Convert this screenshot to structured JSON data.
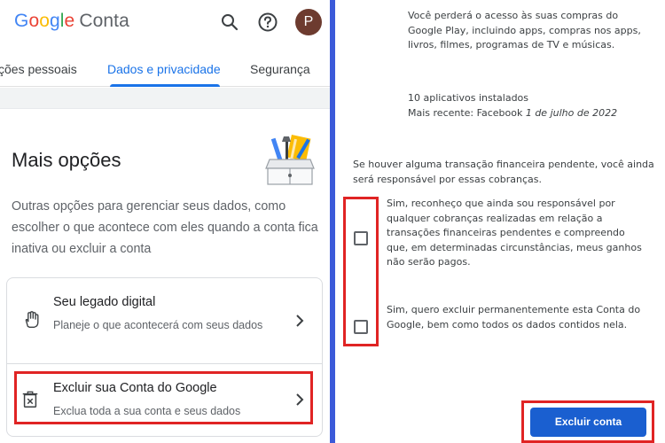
{
  "header": {
    "logo_google": [
      "G",
      "o",
      "o",
      "g",
      "l",
      "e"
    ],
    "logo_conta": "Conta",
    "avatar_letter": "P"
  },
  "tabs": [
    {
      "label": "ções pessoais"
    },
    {
      "label": "Dados e privacidade",
      "active": true
    },
    {
      "label": "Segurança"
    }
  ],
  "main": {
    "title": "Mais opções",
    "description": "Outras opções para gerenciar seus dados, como escolher o que acontece com eles quando a conta fica inativa ou excluir a conta"
  },
  "options": [
    {
      "title": "Seu legado digital",
      "subtitle": "Planeje o que acontecerá com seus dados",
      "icon": "hand-icon"
    },
    {
      "title": "Excluir sua Conta do Google",
      "subtitle": "Exclua toda a sua conta e seus dados",
      "icon": "trash-icon"
    }
  ],
  "right": {
    "apps_warning": "Você perderá o acesso às suas compras do Google Play, incluindo apps, compras nos apps, livros, filmes, programas de TV e músicas.",
    "installed_count": "10 aplicativos instalados",
    "recent_prefix": "Mais recente: Facebook ",
    "recent_date": "1 de julho de 2022",
    "pending_notice": "Se houver alguma transação financeira pendente, você ainda será responsável por essas cobranças.",
    "ack_checkbox_label": "Sim, reconheço que ainda sou responsável por qualquer cobranças realizadas em relação a transações financeiras pendentes e compreendo que, em determinadas circunstâncias, meus ganhos não serão pagos.",
    "perm_checkbox_label": "Sim, quero excluir permanentemente esta Conta do Google, bem como todos os dados contidos nela.",
    "delete_button": "Excluir conta"
  },
  "colors": {
    "accent_blue": "#1a73e8",
    "highlight_red": "#e02424",
    "divider_blue": "#3b5ad9",
    "delete_button_bg": "#1a5fd0"
  }
}
